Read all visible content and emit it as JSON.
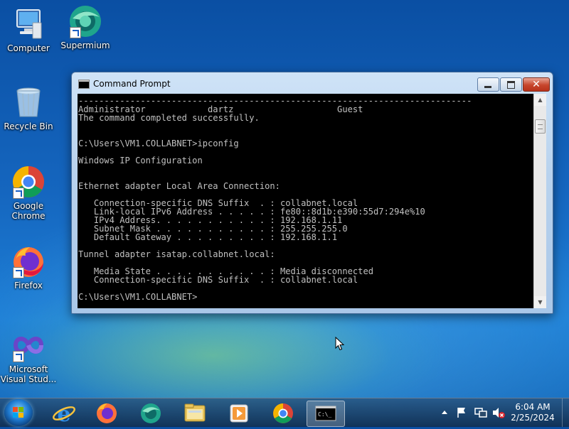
{
  "desktop": {
    "icons": [
      {
        "label": "Computer"
      },
      {
        "label": "Supermium"
      },
      {
        "label": "Recycle Bin"
      },
      {
        "label": "Google\nChrome"
      },
      {
        "label": "Firefox"
      },
      {
        "label": "Microsoft\nVisual Stud..."
      }
    ]
  },
  "window": {
    "title": "Command Prompt",
    "console_text": "----------------------------------------------------------------------------\nAdministrator            dartz                    Guest\nThe command completed successfully.\n\n\nC:\\Users\\VM1.COLLABNET>ipconfig\n\nWindows IP Configuration\n\n\nEthernet adapter Local Area Connection:\n\n   Connection-specific DNS Suffix  . : collabnet.local\n   Link-local IPv6 Address . . . . . : fe80::8d1b:e390:55d7:294e%10\n   IPv4 Address. . . . . . . . . . . : 192.168.1.11\n   Subnet Mask . . . . . . . . . . . : 255.255.255.0\n   Default Gateway . . . . . . . . . : 192.168.1.1\n\nTunnel adapter isatap.collabnet.local:\n\n   Media State . . . . . . . . . . . : Media disconnected\n   Connection-specific DNS Suffix  . : collabnet.local\n\nC:\\Users\\VM1.COLLABNET>"
  },
  "taskbar": {
    "pinned": [
      "Internet Explorer",
      "Firefox",
      "Supermium",
      "Windows Explorer",
      "Media Player",
      "Google Chrome",
      "Command Prompt"
    ],
    "clock": {
      "time": "6:04 AM",
      "date": "2/25/2024"
    }
  },
  "colors": {
    "console_bg": "#000000",
    "console_fg": "#c0c0c0",
    "close_button": "#c7452c"
  }
}
